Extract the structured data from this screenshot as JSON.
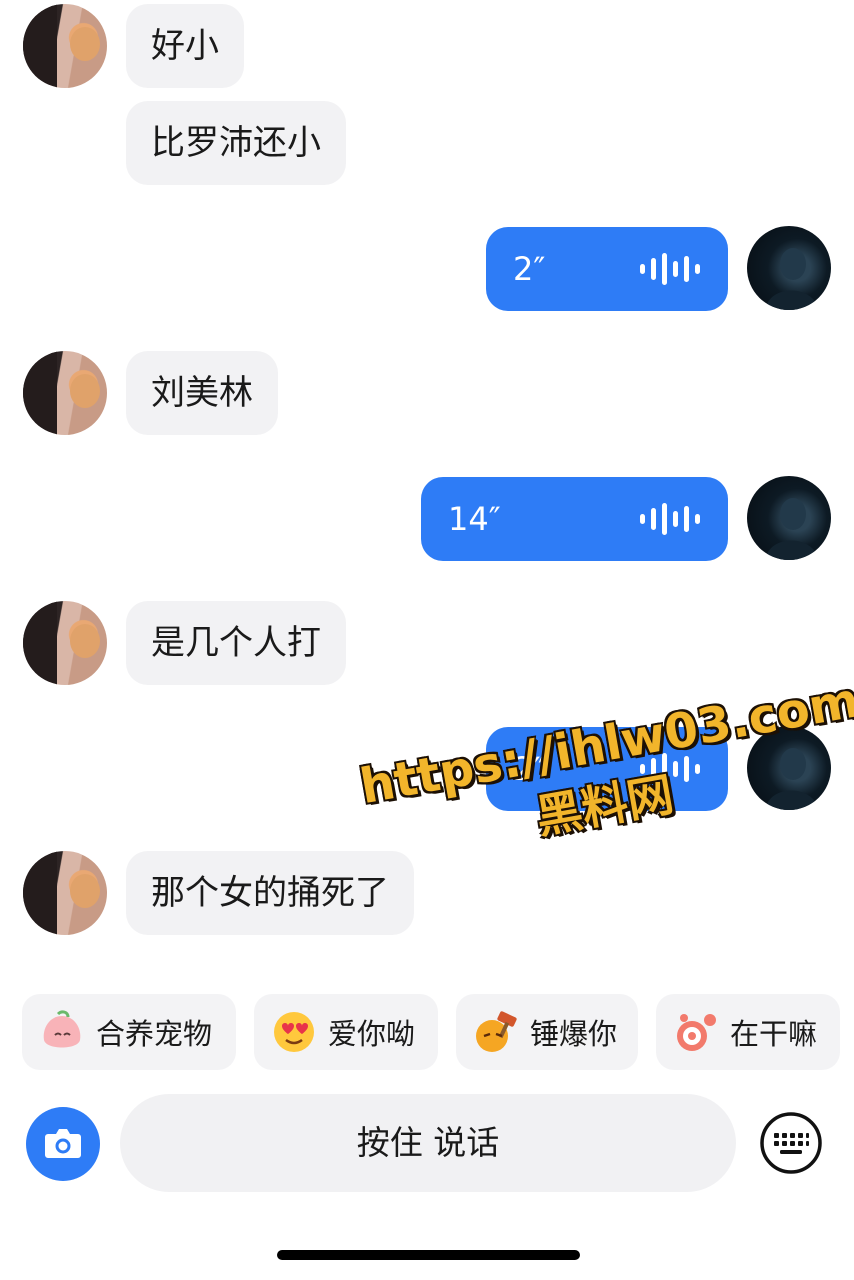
{
  "messages": [
    {
      "side": "left",
      "type": "text",
      "text": "好小"
    },
    {
      "side": "left",
      "type": "text",
      "text": "比罗沛还小"
    },
    {
      "side": "right",
      "type": "voice",
      "duration": "2″"
    },
    {
      "side": "left",
      "type": "text",
      "text": "刘美林"
    },
    {
      "side": "right",
      "type": "voice",
      "duration": "14″"
    },
    {
      "side": "left",
      "type": "text",
      "text": "是几个人打"
    },
    {
      "side": "right",
      "type": "voice",
      "duration": "2″"
    },
    {
      "side": "left",
      "type": "text",
      "text": "那个女的捅死了"
    }
  ],
  "quick_replies": [
    {
      "label": "合养宠物",
      "icon": "peach-pet-icon"
    },
    {
      "label": "爱你呦",
      "icon": "heart-eyes-emoji-icon"
    },
    {
      "label": "锤爆你",
      "icon": "hammer-emoji-icon"
    },
    {
      "label": "在干嘛",
      "icon": "curious-pet-icon"
    }
  ],
  "input_bar": {
    "camera_icon": "camera-icon",
    "talk_label": "按住 说话",
    "keyboard_icon": "keyboard-icon"
  },
  "watermark": {
    "url": "https://ihlw03.com",
    "site": "黑料网"
  },
  "colors": {
    "voice_bubble": "#2e7cf6",
    "received_bubble": "#f2f2f4",
    "watermark": "#f2b52b"
  }
}
